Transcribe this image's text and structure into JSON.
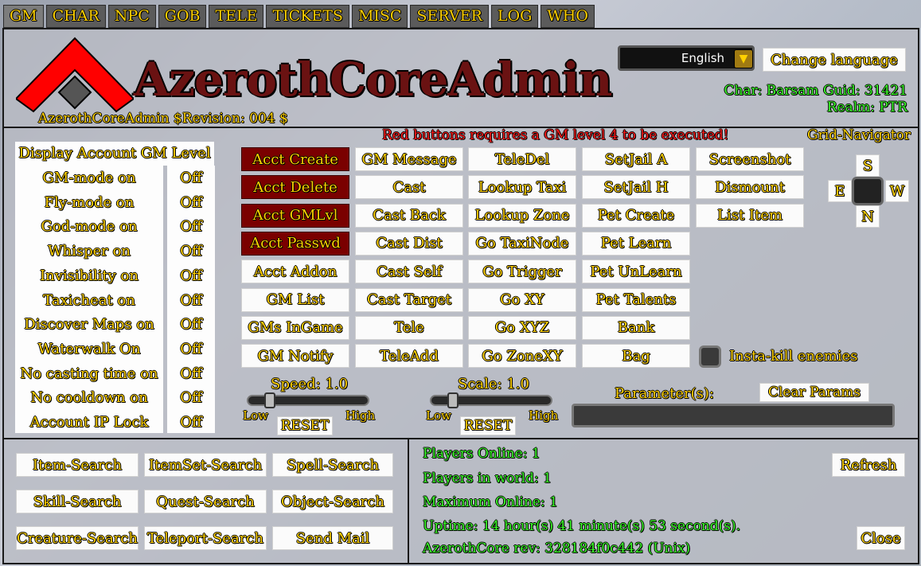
{
  "tabs": [
    "GM",
    "CHAR",
    "NPC",
    "GOB",
    "TELE",
    "TICKETS",
    "MISC",
    "SERVER",
    "LOG",
    "WHO"
  ],
  "header": {
    "logo_title": "AzerothCoreAdmin",
    "revision": "AzerothCoreAdmin $Revision: 004 $",
    "language": "English",
    "change_language": "Change language",
    "char_info": "Char: Barsam Guid: 31421",
    "realm_info": "Realm: PTR"
  },
  "notice": "Red buttons requires a GM level 4 to be executed!",
  "toggles": {
    "title": "Display Account GM Level",
    "items": [
      {
        "label": "GM-mode on",
        "value": "Off"
      },
      {
        "label": "Fly-mode on",
        "value": "Off"
      },
      {
        "label": "God-mode on",
        "value": "Off"
      },
      {
        "label": "Whisper on",
        "value": "Off"
      },
      {
        "label": "Invisibility on",
        "value": "Off"
      },
      {
        "label": "Taxicheat on",
        "value": "Off"
      },
      {
        "label": "Discover Maps on",
        "value": "Off"
      },
      {
        "label": "Waterwalk On",
        "value": "Off"
      },
      {
        "label": "No casting time on",
        "value": "Off"
      },
      {
        "label": "No cooldown on",
        "value": "Off"
      },
      {
        "label": "Account IP Lock",
        "value": "Off"
      }
    ]
  },
  "commands": {
    "col1": [
      "Acct Create",
      "Acct Delete",
      "Acct GMLvl",
      "Acct Passwd",
      "Acct Addon",
      "GM List",
      "GMs InGame",
      "GM Notify"
    ],
    "col2": [
      "GM Message",
      "Cast",
      "Cast Back",
      "Cast Dist",
      "Cast Self",
      "Cast Target",
      "Tele",
      "TeleAdd"
    ],
    "col3": [
      "TeleDel",
      "Lookup Taxi",
      "Lookup Zone",
      "Go TaxiNode",
      "Go Trigger",
      "Go XY",
      "Go XYZ",
      "Go ZoneXY"
    ],
    "col4": [
      "SetJail A",
      "SetJail H",
      "Pet Create",
      "Pet Learn",
      "Pet UnLearn",
      "Pet Talents",
      "Bank",
      "Bag"
    ],
    "col5": [
      "Screenshot",
      "Dismount",
      "List Item"
    ]
  },
  "insta_kill_label": "Insta-kill enemies",
  "grid_navigator": {
    "title": "Grid-Navigator",
    "s": "S",
    "e": "E",
    "w": "W",
    "n": "N"
  },
  "speed": {
    "label": "Speed: 1.0",
    "low": "Low",
    "high": "High",
    "reset": "RESET",
    "value": 1.0
  },
  "scale": {
    "label": "Scale: 1.0",
    "low": "Low",
    "high": "High",
    "reset": "RESET",
    "value": 1.0
  },
  "parameters": {
    "label": "Parameter(s):",
    "clear": "Clear Params",
    "value": ""
  },
  "search": {
    "item": "Item-Search",
    "itemset": "ItemSet-Search",
    "spell": "Spell-Search",
    "skill": "Skill-Search",
    "quest": "Quest-Search",
    "object": "Object-Search",
    "creature": "Creature-Search",
    "teleport": "Teleport-Search",
    "mail": "Send Mail"
  },
  "server": {
    "players_online": "Players Online: 1",
    "players_world": "Players in world: 1",
    "max_online": "Maximum Online: 1",
    "uptime": "Uptime: 14 hour(s) 41 minute(s) 53 second(s).",
    "revision": "AzerothCore rev: 328184f0c442 (Unix)",
    "refresh": "Refresh",
    "close": "Close"
  },
  "colors": {
    "gold": "#ffd100",
    "green": "#3cff2a",
    "red_button": "#7a0000",
    "notice_red": "#ff1a1a",
    "logo_red": "#ff0000"
  }
}
